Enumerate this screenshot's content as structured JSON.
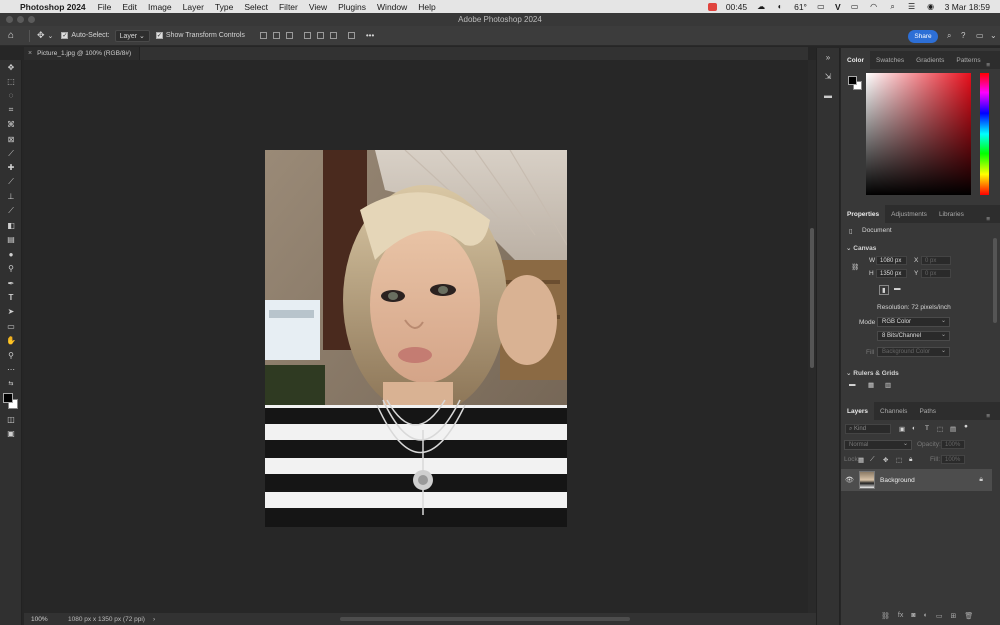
{
  "menubar": {
    "apple": "",
    "app_name": "Photoshop 2024",
    "items": [
      "File",
      "Edit",
      "Image",
      "Layer",
      "Type",
      "Select",
      "Filter",
      "View",
      "Plugins",
      "Window",
      "Help"
    ],
    "time_rec": "00:45",
    "temperature": "61°",
    "vpn": "V",
    "date_time": "3 Mar  18:59"
  },
  "window": {
    "title": "Adobe Photoshop 2024"
  },
  "options": {
    "auto_select_label": "Auto-Select:",
    "auto_select_value": "Layer",
    "transform_label": "Show Transform Controls",
    "more": "•••",
    "share_label": "Share"
  },
  "document": {
    "tab_title": "Picture_1.jpg @ 100% (RGB/8#)",
    "tab_close": "×"
  },
  "status": {
    "zoom": "100%",
    "doc_info": "1080 px x 1350 px (72 ppi)",
    "arrow": "›"
  },
  "color_panel": {
    "tabs": [
      "Color",
      "Swatches",
      "Gradients",
      "Patterns"
    ],
    "menu": "≡"
  },
  "properties_panel": {
    "tabs": [
      "Properties",
      "Adjustments",
      "Libraries"
    ],
    "doc_label": "Document",
    "canvas_section": "Canvas",
    "w_label": "W",
    "w_value": "1080 px",
    "h_label": "H",
    "h_value": "1350 px",
    "x_label": "X",
    "x_value": "0 px",
    "y_label": "Y",
    "y_value": "0 px",
    "resolution": "Resolution: 72 pixels/inch",
    "mode_label": "Mode",
    "mode_value": "RGB Color",
    "bits_value": "8 Bits/Channel",
    "fill_label": "Fill",
    "fill_value": "Background Color",
    "rulers_section": "Rulers & Grids"
  },
  "layers_panel": {
    "tabs": [
      "Layers",
      "Channels",
      "Paths"
    ],
    "kind_placeholder": "Kind",
    "blend_mode": "Normal",
    "opacity_label": "Opacity:",
    "opacity_value": "100%",
    "lock_label": "Lock:",
    "fill_label": "Fill:",
    "fill_value": "100%",
    "layers": [
      {
        "name": "Background",
        "visible": true,
        "locked": true
      }
    ]
  },
  "colors": {
    "foreground": "#000000",
    "background": "#ffffff",
    "share_button": "#2d6fd6"
  }
}
